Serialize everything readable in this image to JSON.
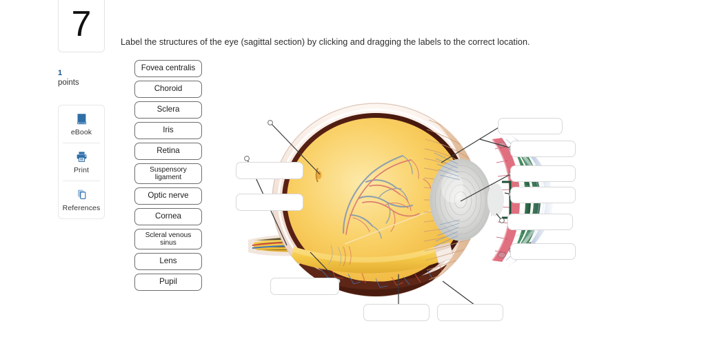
{
  "sidebar": {
    "question_number": "7",
    "points_value": "1",
    "points_label": "points",
    "tools": [
      {
        "icon": "book-icon",
        "label": "eBook"
      },
      {
        "icon": "printer-icon",
        "label": "Print"
      },
      {
        "icon": "references-icon",
        "label": "References"
      }
    ]
  },
  "prompt": "Label the structures of the eye (sagittal section) by clicking and dragging the labels to the correct location.",
  "labels": [
    {
      "text": "Fovea centralis",
      "lines": [
        "Fovea centralis"
      ]
    },
    {
      "text": "Choroid",
      "lines": [
        "Choroid"
      ]
    },
    {
      "text": "Sclera",
      "lines": [
        "Sclera"
      ]
    },
    {
      "text": "Iris",
      "lines": [
        "Iris"
      ]
    },
    {
      "text": "Retina",
      "lines": [
        "Retina"
      ]
    },
    {
      "text": "Suspensory ligament",
      "lines": [
        "Suspensory",
        "ligament"
      ]
    },
    {
      "text": "Optic nerve",
      "lines": [
        "Optic nerve"
      ]
    },
    {
      "text": "Cornea",
      "lines": [
        "Cornea"
      ]
    },
    {
      "text": "Scleral venous sinus",
      "lines": [
        "Scleral venous",
        "sinus"
      ]
    },
    {
      "text": "Lens",
      "lines": [
        "Lens"
      ]
    },
    {
      "text": "Pupil",
      "lines": [
        "Pupil"
      ]
    }
  ],
  "drop_targets": [
    {
      "id": "dt-left-1",
      "value": ""
    },
    {
      "id": "dt-left-2",
      "value": ""
    },
    {
      "id": "dt-bottom-1",
      "value": ""
    },
    {
      "id": "dt-bottom-2",
      "value": ""
    },
    {
      "id": "dt-bottom-3",
      "value": ""
    },
    {
      "id": "dt-right-1",
      "value": ""
    },
    {
      "id": "dt-right-2",
      "value": ""
    },
    {
      "id": "dt-right-3",
      "value": ""
    },
    {
      "id": "dt-right-4",
      "value": ""
    },
    {
      "id": "dt-right-5",
      "value": ""
    },
    {
      "id": "dt-right-6",
      "value": ""
    }
  ],
  "figure": {
    "name": "eye-sagittal-section-diagram",
    "colors": {
      "sclera": "#f2e4dc",
      "choroid": "#5c2317",
      "retina": "#f6c44a",
      "vitreous": "#f8cf62",
      "ciliary_body": "#e7c3a4",
      "iris": "#e8788a",
      "anterior_chamber": "#2f6b4a",
      "cornea": "#b9c8e0",
      "lens": "#d9dadb",
      "optic_nerve": "#f4cf5e",
      "artery": "#d8564a",
      "vein": "#3f77bd",
      "leader_line": "#3a3a3a"
    }
  },
  "theme": {
    "accent": "#2f6fa8",
    "chip_border": "#6d6d6d",
    "drop_border": "#d8d8da",
    "text": "#2b2b2b"
  }
}
